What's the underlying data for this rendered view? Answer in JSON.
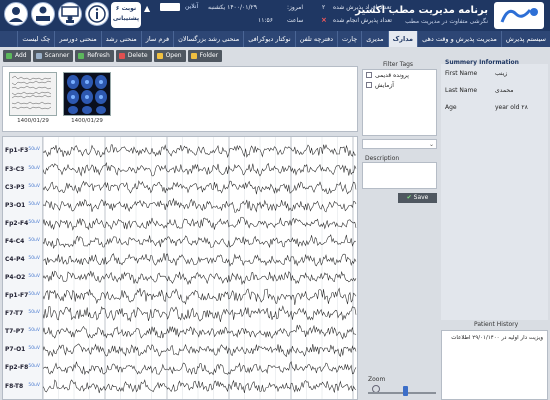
{
  "header": {
    "brand_title": "برنامه مدیریت مطب اکسیر",
    "brand_subtitle": "نگرشی متفاوت در مدیریت مطب",
    "waiting_count_label": "تعداد افراد پذیرش شده",
    "waiting_count_value": "۲",
    "finished_label": "تعداد پذیرش انجام شده",
    "today_label": "امروز:",
    "today_date": "۱۴۰۰/۰۱/۲۹ یکشنبه",
    "time_label": "ساعت",
    "time_value": "۱۱:۵۶",
    "online_label": "آنلاین",
    "badge_line1": "۶ نوبت",
    "badge_line2": "پشتیبانی",
    "icon_names": [
      "user-icon",
      "reception-icon",
      "teacher-icon",
      "info-icon"
    ]
  },
  "nav": {
    "tabs": [
      {
        "label": "سیستم پذیرش",
        "active": false
      },
      {
        "label": "مدیریت پذیرش و وقت دهی",
        "active": false
      },
      {
        "label": "مدارک",
        "active": true
      },
      {
        "label": "مدیری",
        "active": false
      },
      {
        "label": "چارت",
        "active": false
      },
      {
        "label": "دفترچه تلفن",
        "active": false
      },
      {
        "label": "نوکتار دیوکرافی",
        "active": false
      },
      {
        "label": "منحنی رشد بزرگسالان",
        "active": false
      },
      {
        "label": "فرم ساز",
        "active": false
      },
      {
        "label": "منحنی رشد",
        "active": false
      },
      {
        "label": "منحنی دورسر",
        "active": false
      },
      {
        "label": "چک لیست",
        "active": false
      }
    ]
  },
  "toolbar": {
    "buttons": [
      {
        "label": "Add",
        "icon": "add-icon",
        "color": "#5cb85c"
      },
      {
        "label": "Scanner",
        "icon": "scanner-icon",
        "color": "#9ab0c8"
      },
      {
        "label": "Refresh",
        "icon": "refresh-icon",
        "color": "#5cb85c"
      },
      {
        "label": "Delete",
        "icon": "delete-icon",
        "color": "#e05050"
      },
      {
        "label": "Open",
        "icon": "open-icon",
        "color": "#f0c040"
      },
      {
        "label": "Folder",
        "icon": "folder-icon",
        "color": "#f0c040"
      }
    ]
  },
  "thumbnails": [
    {
      "caption": "1400/01/29",
      "kind": "eeg"
    },
    {
      "caption": "1400/01/29",
      "kind": "mri"
    }
  ],
  "eeg": {
    "unit_label": "50uV",
    "channels": [
      "Fp1-F3",
      "F3-C3",
      "C3-P3",
      "P3-O1",
      "Fp2-F4",
      "F4-C4",
      "C4-P4",
      "P4-O2",
      "Fp1-F7",
      "F7-T7",
      "T7-P7",
      "P7-O1",
      "Fp2-F8",
      "F8-T8"
    ]
  },
  "filter": {
    "title": "Filter Tags",
    "tags": [
      {
        "label": "پرونده قدیمی"
      },
      {
        "label": "آزمایش"
      }
    ],
    "description_label": "Description",
    "save_label": "Save"
  },
  "summary": {
    "title": "Summery Information",
    "first_name_label": "First Name",
    "first_name_value": "زینب",
    "last_name_label": "Last Name",
    "last_name_value": "محمدی",
    "age_label": "Age",
    "age_value": "۲۸ year old"
  },
  "history": {
    "title": "Patient History",
    "entries": [
      "ویزیت دار اولیه در ۲۹/۰۱/۱۴۰۰ اطلاعات"
    ]
  },
  "zoom": {
    "label": "Zoom",
    "level": 0.55
  }
}
